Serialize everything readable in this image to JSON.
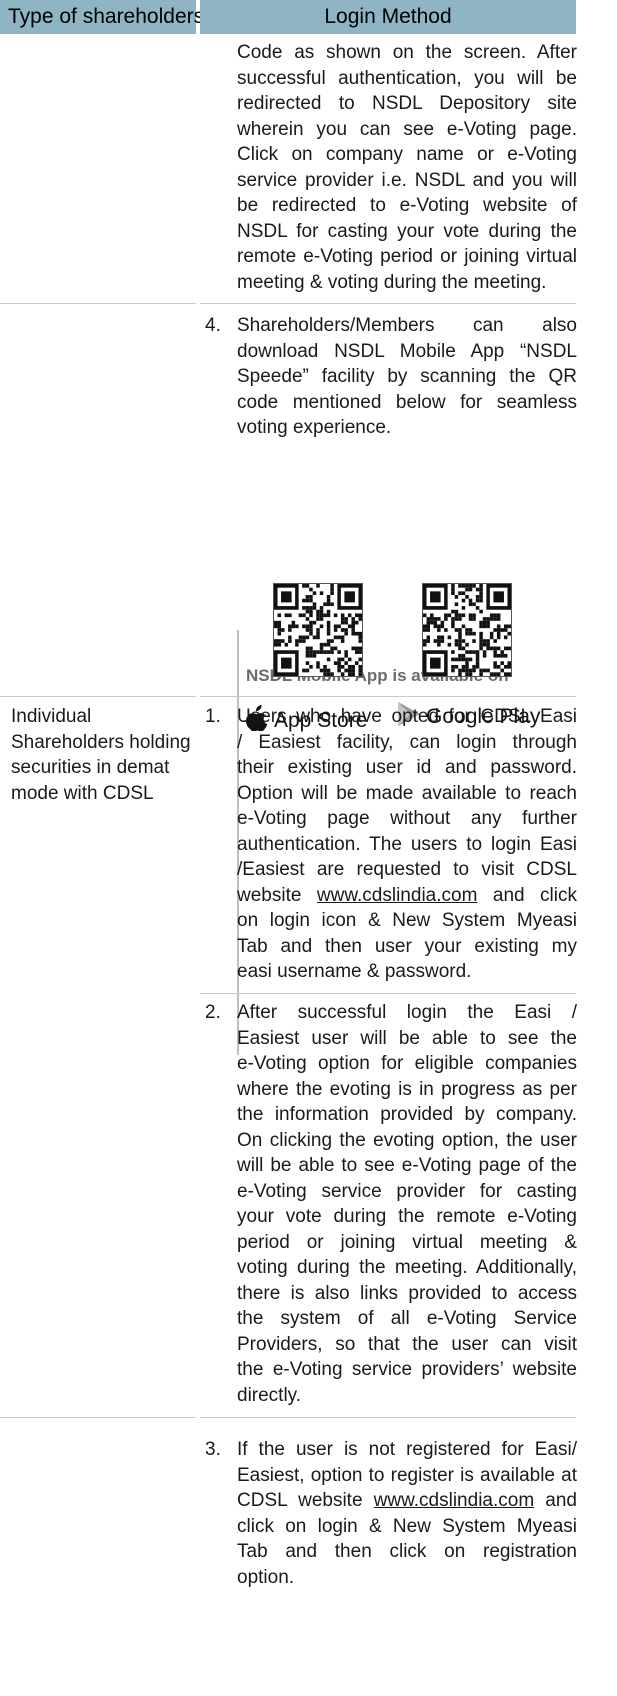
{
  "header": {
    "col1": "Type of shareholders",
    "col2": "Login Method"
  },
  "nsdl": {
    "cont_lines": [
      "Code as shown on the screen. After",
      "successful authentication, you will be",
      "redirected to NSDL Depository site",
      "wherein you can see e-Voting page.",
      "Click on company name or e-Voting",
      "service provider i.e. NSDL and you will",
      "be redirected to e-Voting website of",
      "NSDL for casting your vote during the",
      "remote e-Voting period or joining virtual",
      "meeting & voting during the meeting."
    ],
    "item4_num": "4.",
    "item4_lines": [
      "Shareholders/Members can also",
      "download NSDL Mobile App “NSDL",
      "Speede” facility by scanning the QR",
      "code mentioned below for seamless",
      "voting experience."
    ],
    "app_title": "NSDL Mobile App is available on",
    "app_store": "App Store",
    "google_play": "Google Play",
    "apple_icon": "apple-icon",
    "play_icon": "google-play-icon"
  },
  "cdsl": {
    "type_lines": [
      "Individual",
      "Shareholders holding",
      "securities in demat",
      "mode with CDSL"
    ],
    "item1_num": "1.",
    "item1_lines": [
      "Users who have opted for CDSL Easi",
      "/ Easiest facility, can login through",
      "their existing user id and password.",
      "Option will be made available to reach",
      "e-Voting page without any further",
      "authentication. The users to login Easi",
      "/Easiest are requested to visit CDSL",
      "website {link} and click",
      "on login icon & New System Myeasi",
      "Tab and then user your existing my",
      "easi username & password."
    ],
    "item2_num": "2.",
    "item2_lines": [
      "After successful login the Easi /",
      "Easiest user will be able to see the",
      "e-Voting option for eligible companies",
      "where the evoting is in progress as per",
      "the information provided by company.",
      "On clicking the evoting option, the user",
      "will be able to see e-Voting page of the",
      "e-Voting service provider for casting",
      "your vote during the remote e-Voting",
      "period or joining virtual meeting &",
      "voting during the meeting. Additionally,",
      "there is also links provided to access",
      "the system of all e-Voting Service",
      "Providers, so that the user can visit",
      "the e-Voting service providers’ website",
      "directly."
    ],
    "item3_num": "3.",
    "item3_lines": [
      "If the user is not registered for Easi/",
      "Easiest, option to register is available at",
      "CDSL website {link} and",
      "click on login & New System Myeasi",
      "Tab and then click on registration",
      "option."
    ],
    "link_text": "www.cdslindia.com"
  }
}
